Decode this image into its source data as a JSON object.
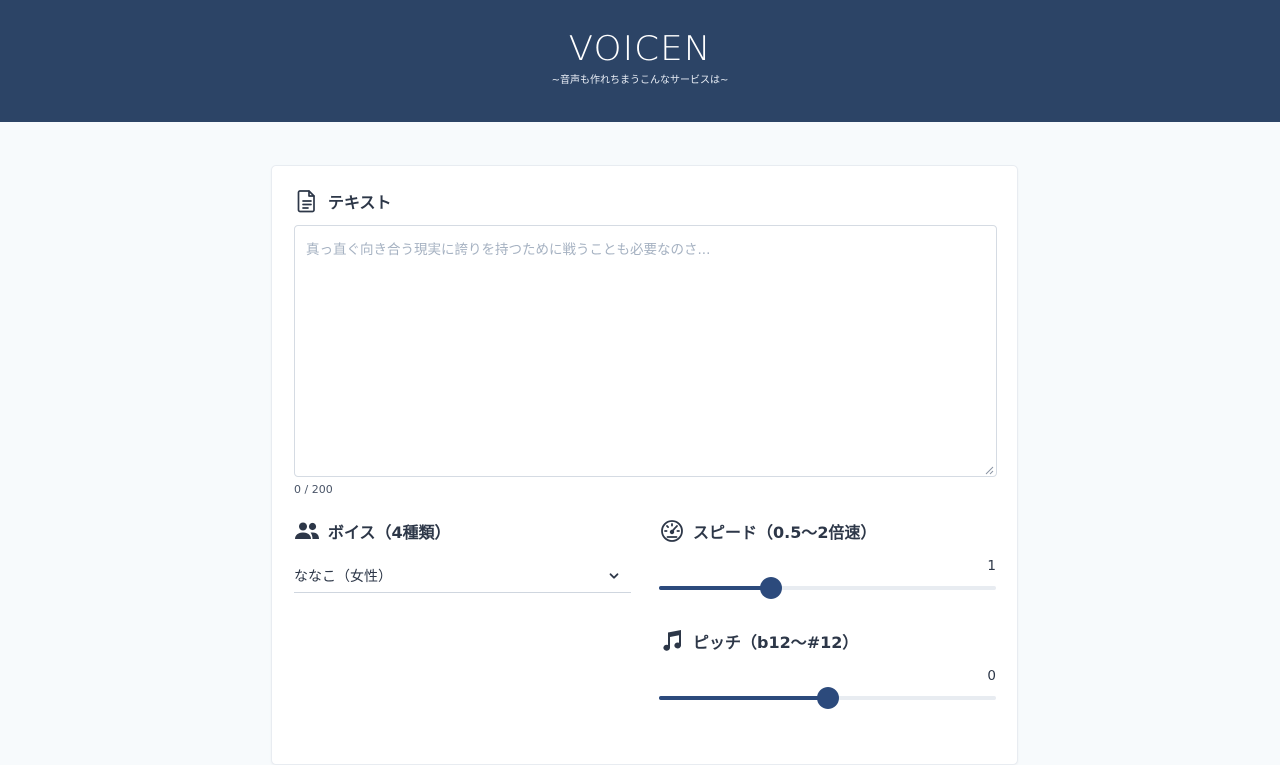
{
  "header": {
    "logo": "VOICEN",
    "tagline": "~音声も作れちまうこんなサービスは~"
  },
  "text_section": {
    "title": "テキスト",
    "icon": "document-icon",
    "placeholder": "真っ直ぐ向き合う現実に誇りを持つために戦うことも必要なのさ...",
    "value": "",
    "counter": "0 / 200"
  },
  "voice_section": {
    "title": "ボイス（4種類）",
    "icon": "people-icon",
    "selected": "ななこ（女性）"
  },
  "speed_section": {
    "title": "スピード（0.5〜2倍速）",
    "icon": "speedometer-icon",
    "value_label": "1",
    "fraction": 0.333
  },
  "pitch_section": {
    "title": "ピッチ（b12〜#12）",
    "icon": "music-note-icon",
    "value_label": "0",
    "fraction": 0.5
  },
  "colors": {
    "header_bg": "#2c4466",
    "accent": "#2c4a7c",
    "page_bg": "#f7fafc"
  }
}
